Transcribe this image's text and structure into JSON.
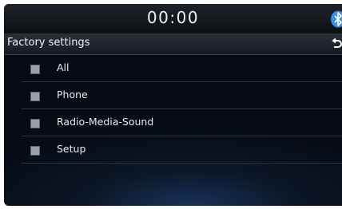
{
  "status": {
    "time": "00:00",
    "icon": "bluetooth-icon"
  },
  "header": {
    "title": "Factory settings",
    "back_icon": "back-icon"
  },
  "options": [
    {
      "label": "All",
      "checked": false
    },
    {
      "label": "Phone",
      "checked": false
    },
    {
      "label": "Radio-Media-Sound",
      "checked": false
    },
    {
      "label": "Setup",
      "checked": false
    }
  ],
  "colors": {
    "accent": "#3d8fe0",
    "background": "#0b1626"
  }
}
